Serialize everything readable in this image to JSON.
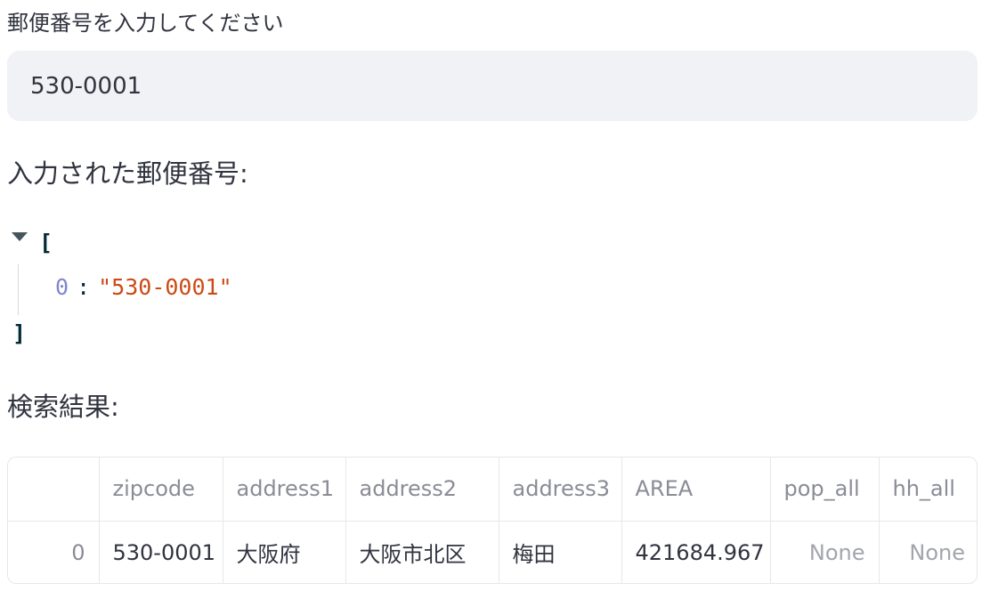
{
  "zip_input": {
    "label": "郵便番号を入力してください",
    "value": "530-0001"
  },
  "entered": {
    "label": "入力された郵便番号:",
    "json_open": "[",
    "json_close": "]",
    "items": [
      {
        "key": "0",
        "value": "\"530-0001\""
      }
    ]
  },
  "results": {
    "label": "検索結果:",
    "columns": [
      "",
      "zipcode",
      "address1",
      "address2",
      "address3",
      "AREA",
      "pop_all",
      "hh_all"
    ],
    "rows": [
      [
        "0",
        "530-0001",
        "大阪府",
        "大阪市北区",
        "梅田",
        "421684.967",
        "None",
        "None"
      ]
    ]
  }
}
